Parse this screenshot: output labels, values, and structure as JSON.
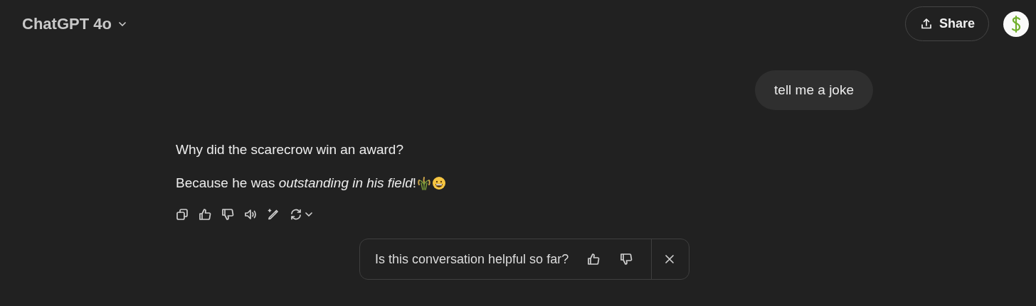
{
  "header": {
    "model": "ChatGPT 4o",
    "share": "Share"
  },
  "messages": [
    {
      "kind": "user",
      "text": "tell me a joke"
    },
    {
      "kind": "assistant",
      "paragraphs": [
        "Why did the scarecrow win an award?",
        "Because he was *outstanding in his field*!"
      ]
    }
  ],
  "feedback": {
    "question": "Is this conversation helpful so far?"
  }
}
